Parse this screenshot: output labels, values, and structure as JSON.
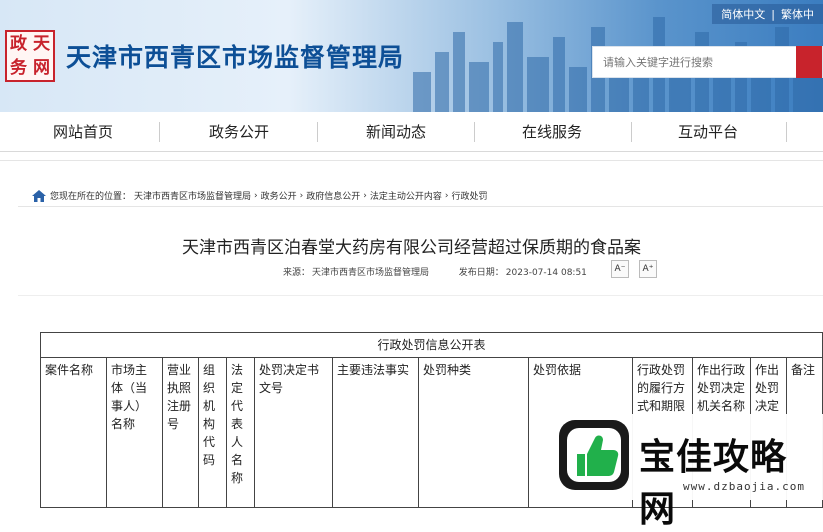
{
  "header": {
    "lang_simplified": "简体中文",
    "lang_sep": "|",
    "lang_traditional": "繁体中",
    "seal_chars": [
      "政",
      "天",
      "务",
      "网"
    ],
    "site_title": "天津市西青区市场监督管理局",
    "search_placeholder": "请输入关键字进行搜索"
  },
  "nav": {
    "items": [
      "网站首页",
      "政务公开",
      "新闻动态",
      "在线服务",
      "互动平台"
    ]
  },
  "breadcrumb": {
    "prefix": "您现在所在的位置：",
    "items": [
      "天津市西青区市场监督管理局",
      "政务公开",
      "政府信息公开",
      "法定主动公开内容",
      "行政处罚"
    ],
    "sep": "›"
  },
  "article": {
    "title": "天津市西青区泊春堂大药房有限公司经营超过保质期的食品案",
    "source_label": "来源：",
    "source": "天津市西青区市场监督管理局",
    "date_label": "发布日期：",
    "date": "2023-07-14 08:51",
    "font_minus": "A⁻",
    "font_plus": "A⁺"
  },
  "table": {
    "caption": "行政处罚信息公开表",
    "headers": [
      "案件名称",
      "市场主体（当事人）名称",
      "营业执照注册号",
      "组织机构代码",
      "法定代表人名称",
      "处罚决定书文号",
      "主要违法事实",
      "处罚种类",
      "处罚依据",
      "行政处罚的履行方式和期限",
      "作出行政处罚决定机关名称",
      "作出处罚决定",
      "备注"
    ]
  },
  "watermark": {
    "text": "宝佳攻略网",
    "url": "www.dzbaojia.com"
  },
  "colors": {
    "title_blue": "#0d4f96",
    "seal_red": "#c8232c",
    "search_btn": "#c8232c"
  }
}
